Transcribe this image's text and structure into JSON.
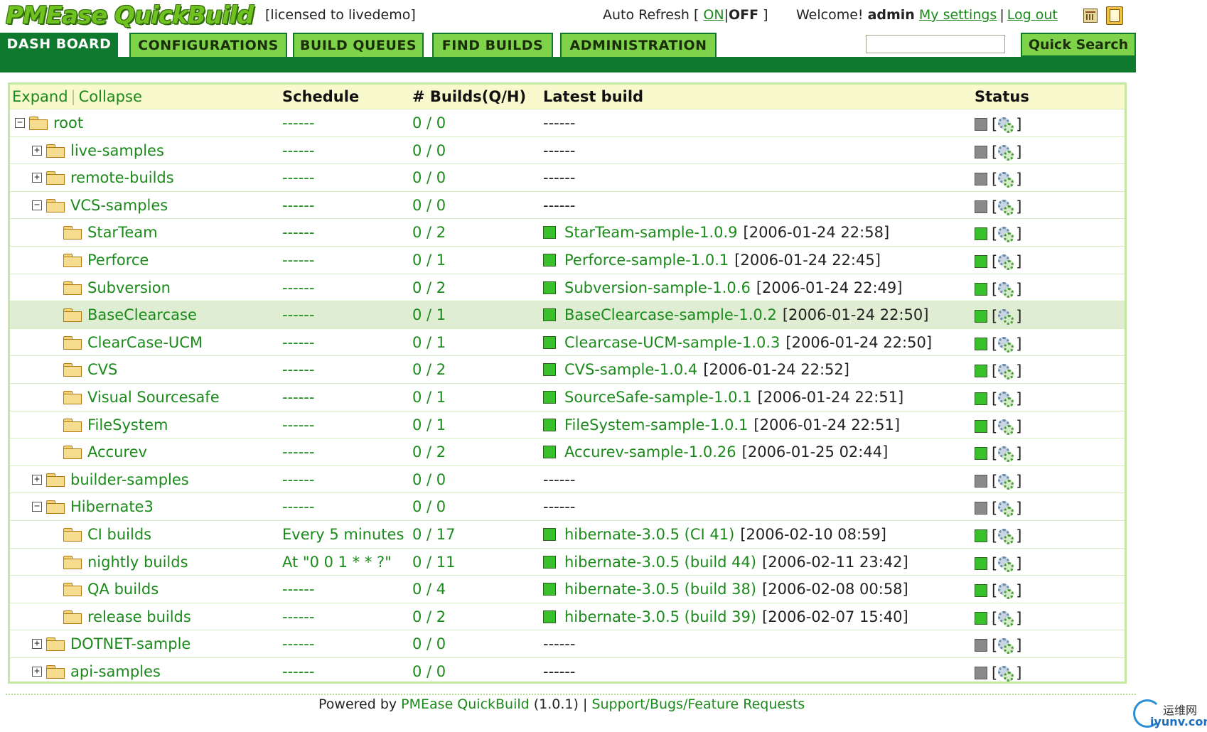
{
  "header": {
    "logo_text": "PMEase QuickBuild",
    "licensed": "[licensed to livedemo]",
    "auto_refresh_label": "Auto Refresh [",
    "auto_refresh_on": "ON",
    "auto_refresh_sep": "|",
    "auto_refresh_off": "OFF",
    "auto_refresh_end": "]",
    "welcome_label": "Welcome!",
    "welcome_user": "admin",
    "my_settings": "My settings",
    "separator": "|",
    "log_out": "Log out"
  },
  "nav": {
    "tabs": [
      {
        "label": "DASH BOARD",
        "active": true
      },
      {
        "label": "CONFIGURATIONS",
        "active": false
      },
      {
        "label": "BUILD QUEUES",
        "active": false
      },
      {
        "label": "FIND BUILDS",
        "active": false
      },
      {
        "label": "ADMINISTRATION",
        "active": false
      }
    ],
    "search_value": "",
    "search_button": "Quick Search"
  },
  "table": {
    "expand": "Expand",
    "collapse": "Collapse",
    "ec_sep": "|",
    "headers": {
      "schedule": "Schedule",
      "builds": "# Builds(Q/H)",
      "latest": "Latest build",
      "status": "Status"
    },
    "rows": [
      {
        "name": "root",
        "level": 0,
        "toggle": "minus",
        "schedule": "------",
        "builds": "0 / 0",
        "latest": "",
        "date": "",
        "latest_dash": "------",
        "status": "gray",
        "highlight": false
      },
      {
        "name": "live-samples",
        "level": 1,
        "toggle": "plus",
        "schedule": "------",
        "builds": "0 / 0",
        "latest": "",
        "date": "",
        "latest_dash": "------",
        "status": "gray",
        "highlight": false
      },
      {
        "name": "remote-builds",
        "level": 1,
        "toggle": "plus",
        "schedule": "------",
        "builds": "0 / 0",
        "latest": "",
        "date": "",
        "latest_dash": "------",
        "status": "gray",
        "highlight": false
      },
      {
        "name": "VCS-samples",
        "level": 1,
        "toggle": "minus",
        "schedule": "------",
        "builds": "0 / 0",
        "latest": "",
        "date": "",
        "latest_dash": "------",
        "status": "gray",
        "highlight": false
      },
      {
        "name": "StarTeam",
        "level": 2,
        "toggle": "",
        "schedule": "------",
        "builds": "0 / 2",
        "latest": "StarTeam-sample-1.0.9",
        "date": "[2006-01-24 22:58]",
        "latest_dash": "",
        "status": "green",
        "highlight": false
      },
      {
        "name": "Perforce",
        "level": 2,
        "toggle": "",
        "schedule": "------",
        "builds": "0 / 1",
        "latest": "Perforce-sample-1.0.1",
        "date": "[2006-01-24 22:45]",
        "latest_dash": "",
        "status": "green",
        "highlight": false
      },
      {
        "name": "Subversion",
        "level": 2,
        "toggle": "",
        "schedule": "------",
        "builds": "0 / 2",
        "latest": "Subversion-sample-1.0.6",
        "date": "[2006-01-24 22:49]",
        "latest_dash": "",
        "status": "green",
        "highlight": false
      },
      {
        "name": "BaseClearcase",
        "level": 2,
        "toggle": "",
        "schedule": "------",
        "builds": "0 / 1",
        "latest": "BaseClearcase-sample-1.0.2",
        "date": "[2006-01-24 22:50]",
        "latest_dash": "",
        "status": "green",
        "highlight": true
      },
      {
        "name": "ClearCase-UCM",
        "level": 2,
        "toggle": "",
        "schedule": "------",
        "builds": "0 / 1",
        "latest": "Clearcase-UCM-sample-1.0.3",
        "date": "[2006-01-24 22:50]",
        "latest_dash": "",
        "status": "green",
        "highlight": false
      },
      {
        "name": "CVS",
        "level": 2,
        "toggle": "",
        "schedule": "------",
        "builds": "0 / 2",
        "latest": "CVS-sample-1.0.4",
        "date": "[2006-01-24 22:52]",
        "latest_dash": "",
        "status": "green",
        "highlight": false
      },
      {
        "name": "Visual Sourcesafe",
        "level": 2,
        "toggle": "",
        "schedule": "------",
        "builds": "0 / 1",
        "latest": "SourceSafe-sample-1.0.1",
        "date": "[2006-01-24 22:51]",
        "latest_dash": "",
        "status": "green",
        "highlight": false
      },
      {
        "name": "FileSystem",
        "level": 2,
        "toggle": "",
        "schedule": "------",
        "builds": "0 / 1",
        "latest": "FileSystem-sample-1.0.1",
        "date": "[2006-01-24 22:51]",
        "latest_dash": "",
        "status": "green",
        "highlight": false
      },
      {
        "name": "Accurev",
        "level": 2,
        "toggle": "",
        "schedule": "------",
        "builds": "0 / 2",
        "latest": "Accurev-sample-1.0.26",
        "date": "[2006-01-25 02:44]",
        "latest_dash": "",
        "status": "green",
        "highlight": false
      },
      {
        "name": "builder-samples",
        "level": 1,
        "toggle": "plus",
        "schedule": "------",
        "builds": "0 / 0",
        "latest": "",
        "date": "",
        "latest_dash": "------",
        "status": "gray",
        "highlight": false
      },
      {
        "name": "Hibernate3",
        "level": 1,
        "toggle": "minus",
        "schedule": "------",
        "builds": "0 / 0",
        "latest": "",
        "date": "",
        "latest_dash": "------",
        "status": "gray",
        "highlight": false
      },
      {
        "name": "CI builds",
        "level": 2,
        "toggle": "",
        "schedule": "Every 5 minutes",
        "builds": "0 / 17",
        "latest": "hibernate-3.0.5 (CI 41)",
        "date": "[2006-02-10 08:59]",
        "latest_dash": "",
        "status": "green",
        "highlight": false
      },
      {
        "name": "nightly builds",
        "level": 2,
        "toggle": "",
        "schedule": "At \"0 0 1 * * ?\"",
        "builds": "0 / 11",
        "latest": "hibernate-3.0.5 (build 44)",
        "date": "[2006-02-11 23:42]",
        "latest_dash": "",
        "status": "green",
        "highlight": false
      },
      {
        "name": "QA builds",
        "level": 2,
        "toggle": "",
        "schedule": "------",
        "builds": "0 / 4",
        "latest": "hibernate-3.0.5 (build 38)",
        "date": "[2006-02-08 00:58]",
        "latest_dash": "",
        "status": "green",
        "highlight": false
      },
      {
        "name": "release builds",
        "level": 2,
        "toggle": "",
        "schedule": "------",
        "builds": "0 / 2",
        "latest": "hibernate-3.0.5 (build 39)",
        "date": "[2006-02-07 15:40]",
        "latest_dash": "",
        "status": "green",
        "highlight": false
      },
      {
        "name": "DOTNET-sample",
        "level": 1,
        "toggle": "plus",
        "schedule": "------",
        "builds": "0 / 0",
        "latest": "",
        "date": "",
        "latest_dash": "------",
        "status": "gray",
        "highlight": false
      },
      {
        "name": "api-samples",
        "level": 1,
        "toggle": "plus",
        "schedule": "------",
        "builds": "0 / 0",
        "latest": "",
        "date": "",
        "latest_dash": "------",
        "status": "gray",
        "highlight": false
      }
    ]
  },
  "footer": {
    "powered_by": "Powered by",
    "product": "PMEase QuickBuild",
    "version": "(1.0.1)",
    "sep": "|",
    "support": "Support/Bugs/Feature Requests"
  },
  "watermark": {
    "cn": "运维网",
    "en": "iyunv.com"
  },
  "colors": {
    "brand_green": "#6fc21f",
    "nav_dark_green": "#0f7a2e",
    "tab_green": "#7fd34b",
    "link_green": "#1a8a1a",
    "status_ok": "#38c12a",
    "status_none": "#8a8a8a",
    "header_row_bg": "#f8f9cc",
    "highlight_row_bg": "#dfeed3"
  },
  "icons": {
    "folder": "folder-icon",
    "expand": "plus-box-icon",
    "collapse": "minus-box-icon",
    "status_square": "status-square-icon",
    "build_gears": "gears-icon",
    "calendar": "calendar-icon",
    "help_book": "book-icon"
  }
}
